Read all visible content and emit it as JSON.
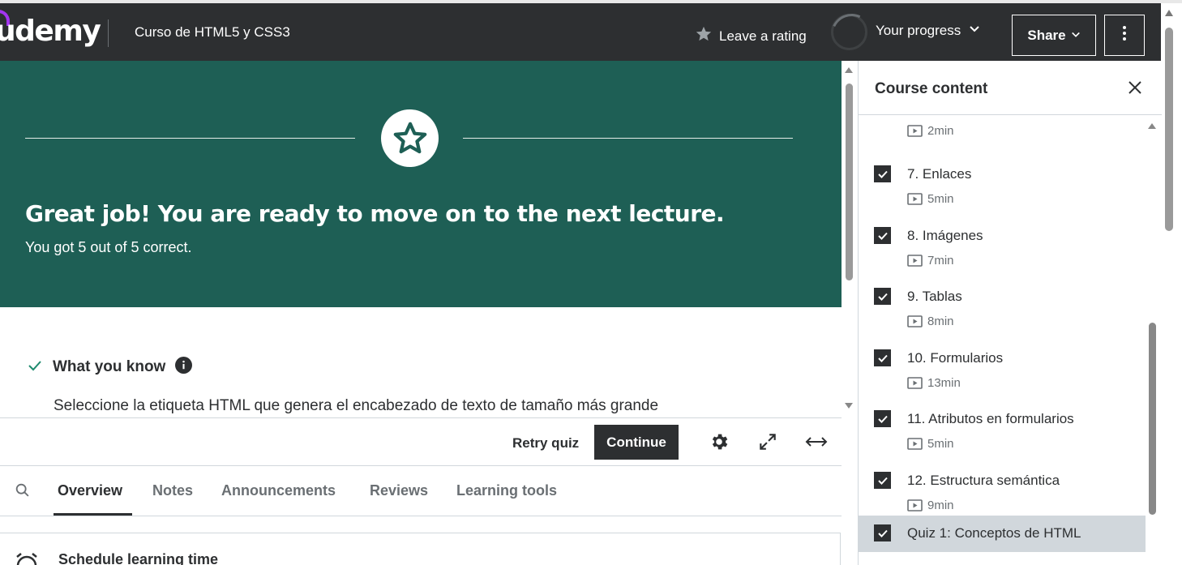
{
  "header": {
    "logo_text": "udemy",
    "course_title": "Curso de HTML5 y CSS3",
    "rating_label": "Leave a rating",
    "progress_label": "Your progress",
    "share_label": "Share"
  },
  "banner": {
    "title": "Great job! You are ready to move on to the next lecture.",
    "subtitle": "You got 5 out of 5 correct.",
    "bg_color": "#1e5f55"
  },
  "results": {
    "section_title": "What you know",
    "question": "Seleccione la etiqueta HTML que genera el encabezado de texto de tamaño más grande"
  },
  "actions": {
    "retry_label": "Retry quiz",
    "continue_label": "Continue"
  },
  "tabs": [
    {
      "label": "Overview",
      "active": true
    },
    {
      "label": "Notes",
      "active": false
    },
    {
      "label": "Announcements",
      "active": false
    },
    {
      "label": "Reviews",
      "active": false
    },
    {
      "label": "Learning tools",
      "active": false
    }
  ],
  "schedule": {
    "title": "Schedule learning time"
  },
  "sidebar": {
    "title": "Course content",
    "first_duration": "2min",
    "lectures": [
      {
        "name": "7. Enlaces",
        "duration": "5min",
        "completed": true
      },
      {
        "name": "8. Imágenes",
        "duration": "7min",
        "completed": true
      },
      {
        "name": "9. Tablas",
        "duration": "8min",
        "completed": true
      },
      {
        "name": "10. Formularios",
        "duration": "13min",
        "completed": true
      },
      {
        "name": "11. Atributos en formularios",
        "duration": "5min",
        "completed": true
      },
      {
        "name": "12. Estructura semántica",
        "duration": "9min",
        "completed": true
      },
      {
        "name": "Quiz 1: Conceptos de HTML",
        "duration": "",
        "completed": true,
        "active": true
      }
    ]
  }
}
